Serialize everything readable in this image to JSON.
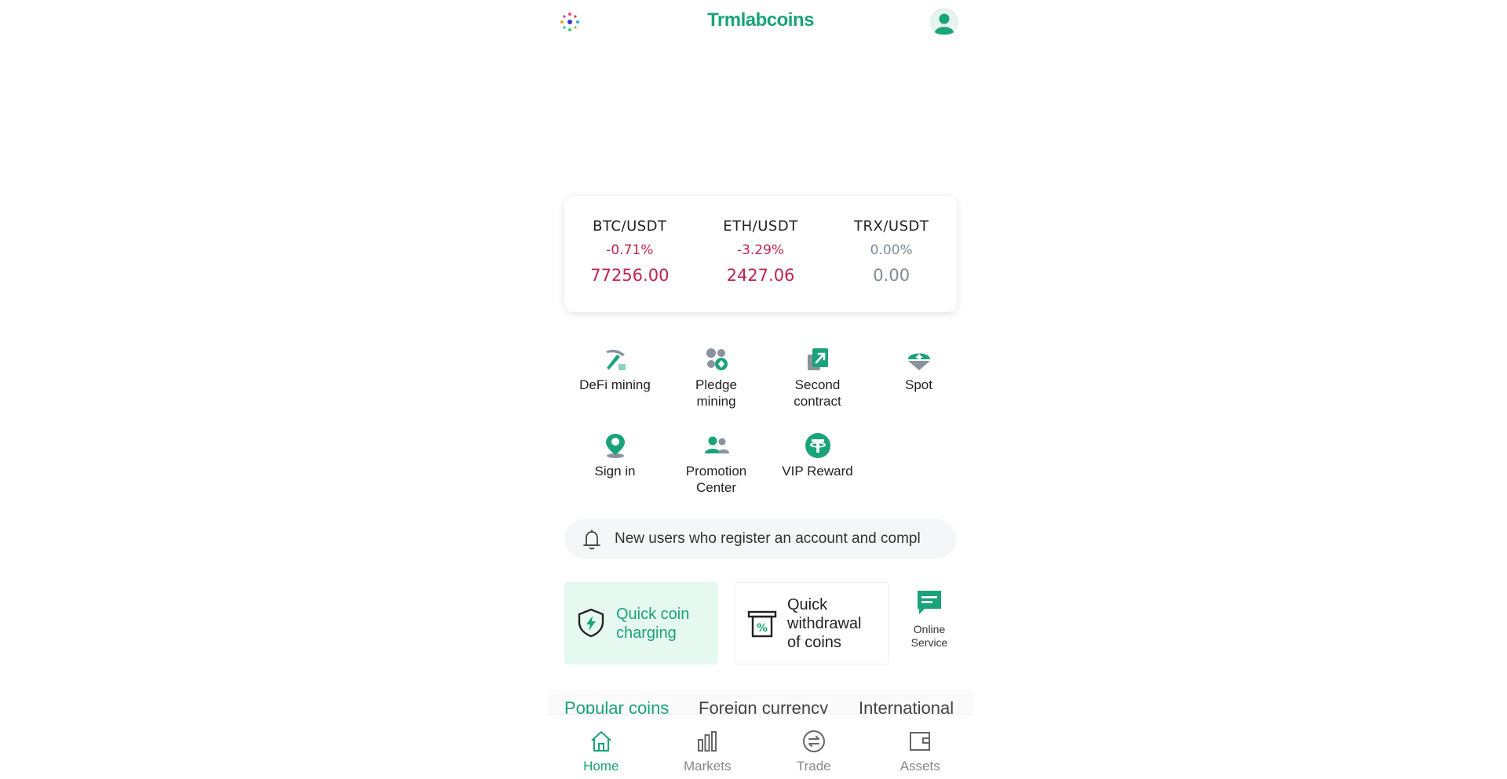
{
  "header": {
    "title": "Trmlabcoins",
    "logo_icon": "sparkle-dots-icon",
    "avatar_icon": "user-avatar-icon"
  },
  "ticker": [
    {
      "pair": "BTC/USDT",
      "change": "-0.71%",
      "price": "77256.00",
      "trend": "down"
    },
    {
      "pair": "ETH/USDT",
      "change": "-3.29%",
      "price": "2427.06",
      "trend": "down"
    },
    {
      "pair": "TRX/USDT",
      "change": "0.00%",
      "price": "0.00",
      "trend": "flat"
    }
  ],
  "menu": {
    "items": [
      {
        "label": "DeFi mining",
        "icon": "pickaxe-icon"
      },
      {
        "label": "Pledge mining",
        "icon": "coins-icon"
      },
      {
        "label": "Second contract",
        "icon": "contract-arrow-icon"
      },
      {
        "label": "Spot",
        "icon": "spot-upload-icon"
      },
      {
        "label": "Sign in",
        "icon": "location-pin-icon"
      },
      {
        "label": "Promotion Center",
        "icon": "users-icon"
      },
      {
        "label": "VIP Reward",
        "icon": "tether-icon"
      }
    ]
  },
  "notice": {
    "text": "New users who register an account and compl",
    "icon": "bell-icon"
  },
  "actions": {
    "quick_charge": "Quick coin charging",
    "quick_withdraw": "Quick withdrawal of coins",
    "online_service": "Online Service"
  },
  "category_tabs": [
    {
      "label": "Popular coins",
      "active": true
    },
    {
      "label": "Foreign currency",
      "active": false
    },
    {
      "label": "International",
      "active": false
    }
  ],
  "tabbar": [
    {
      "label": "Home",
      "icon": "home-icon",
      "active": true
    },
    {
      "label": "Markets",
      "icon": "bar-chart-icon",
      "active": false
    },
    {
      "label": "Trade",
      "icon": "exchange-icon",
      "active": false
    },
    {
      "label": "Assets",
      "icon": "wallet-icon",
      "active": false
    }
  ],
  "colors": {
    "brand": "#1aa37a",
    "down": "#c0244e",
    "flat": "#7d8b97"
  }
}
